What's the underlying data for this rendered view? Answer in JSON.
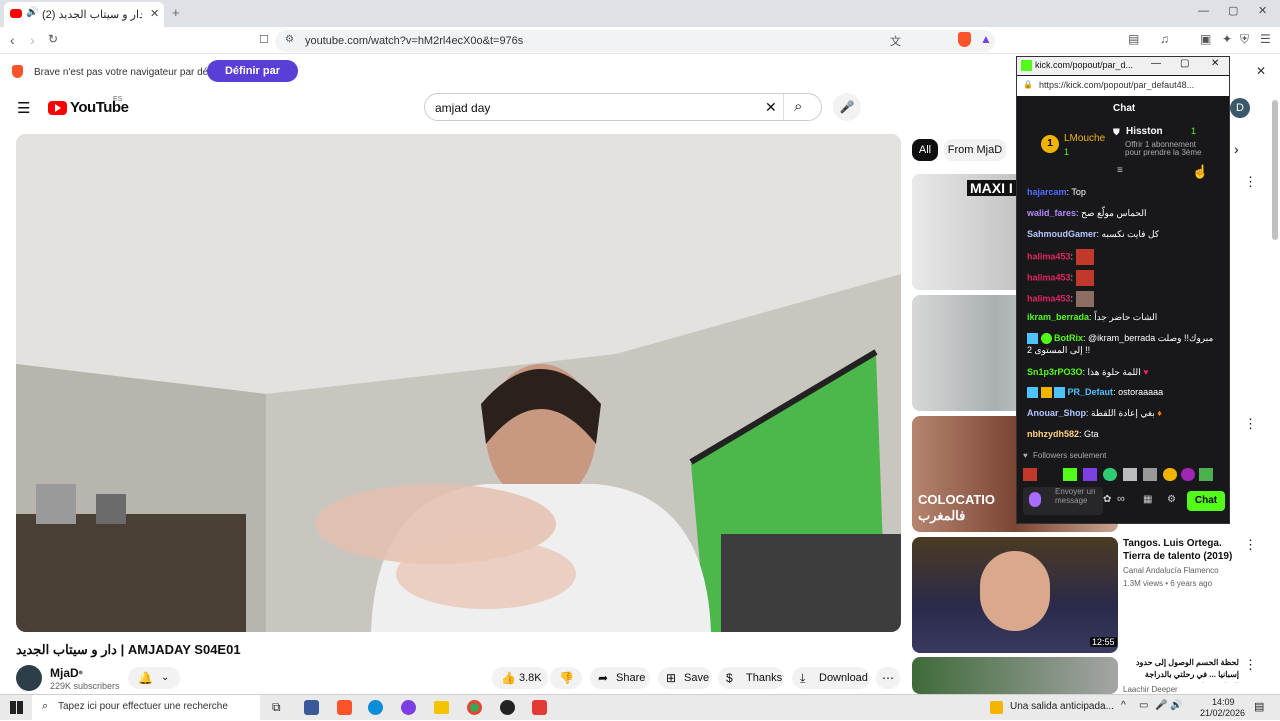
{
  "browser": {
    "tab_title": "(2) دار و سيتاب الجديد | YouTube",
    "url": "youtube.com/watch?v=hM2rl4ecX0o&t=976s",
    "brave_notice": "Brave n'est pas votre navigateur par défaut",
    "set_default_label": "Définir par défaut"
  },
  "youtube": {
    "logo": "YouTube",
    "logo_region": "ES",
    "search_query": "amjad day",
    "chips": [
      "All",
      "From MjaD"
    ],
    "video_title": "دار و سيتاب الجديد | AMJADAY S04E01",
    "channel_name": "MjaD",
    "subscribers": "229K subscribers",
    "actions": {
      "likes": "3.8K",
      "share": "Share",
      "save": "Save",
      "thanks": "Thanks",
      "download": "Download"
    },
    "recommendations": [
      {
        "thumb_text": "MAXI I",
        "title": "",
        "channel": "",
        "meta": "",
        "duration": ""
      },
      {
        "thumb_text": "",
        "title": "",
        "channel": "",
        "meta": "",
        "duration": ""
      },
      {
        "thumb_text": "COLOCATIO فالمغرب",
        "title": "",
        "channel": "",
        "meta": "",
        "duration": ""
      },
      {
        "thumb_text": "",
        "title": "Tangos. Luis Ortega. Tierra de talento (2019)",
        "channel": "Canal Andalucía Flamenco",
        "meta": "1.3M views • 6 years ago",
        "duration": "12:55"
      },
      {
        "thumb_text": "",
        "title": "لحظة الحسم  الوصول إلى حدود إسبانيا ... في رحلتي بالدراجة الهوائية حول",
        "channel": "Laachir Deeper",
        "meta": "",
        "duration": ""
      }
    ]
  },
  "kick": {
    "window_title": "kick.com/popout/par_d...",
    "url": "https://kick.com/popout/par_defaut48...",
    "header": "Chat",
    "top_gifter": {
      "rank": "1",
      "name": "LMouche",
      "count": "1"
    },
    "pinned": {
      "name": "Hisston",
      "count": "1",
      "text": "Offrir 1 abonnement pour prendre la 3ème"
    },
    "messages": [
      {
        "user": "hajarcam",
        "color": "#4f6bff",
        "text": "Top"
      },
      {
        "user": "walid_fares",
        "color": "#b388ff",
        "text": "الحماس مولّع صح"
      },
      {
        "user": "SahmoudGamer",
        "color": "#b3c7ff",
        "text": "كل فايت نكسبه"
      },
      {
        "user": "halima453",
        "color": "#e0245e",
        "text": ""
      },
      {
        "user": "halima453",
        "color": "#e0245e",
        "text": ""
      },
      {
        "user": "halima453",
        "color": "#e0245e",
        "text": ""
      },
      {
        "user": "ikram_berrada",
        "color": "#53fc18",
        "text": "الشات حاضر جداً"
      },
      {
        "user": "BotRix",
        "color": "#53fc18",
        "text": "@ikram_berrada مبروك!! وصلت إلى المستوى 2 !!"
      },
      {
        "user": "Sn1p3rPO3O",
        "color": "#53fc18",
        "text": "اللمة حلوة هذا"
      },
      {
        "user": "PR_Defaut",
        "color": "#4fc3ff",
        "text": "ostoraaaaa"
      },
      {
        "user": "Anouar_Shop",
        "color": "#b3c7ff",
        "text": "بغي إعادة اللقطة"
      },
      {
        "user": "nbhzydh582",
        "color": "#ffd27f",
        "text": "Gta"
      }
    ],
    "followers_only": "Followers seulement",
    "input_placeholder": "Envoyer un message",
    "send_label": "Chat"
  },
  "taskbar": {
    "search_placeholder": "Tapez ici pour effectuer une recherche",
    "news": "Una salida anticipada...",
    "time": "14:09",
    "date": "21/02/2026"
  },
  "colors": {
    "brave_purple": "#5a3fd6",
    "kick_green": "#53fc18",
    "youtube_red": "#ff0000"
  }
}
